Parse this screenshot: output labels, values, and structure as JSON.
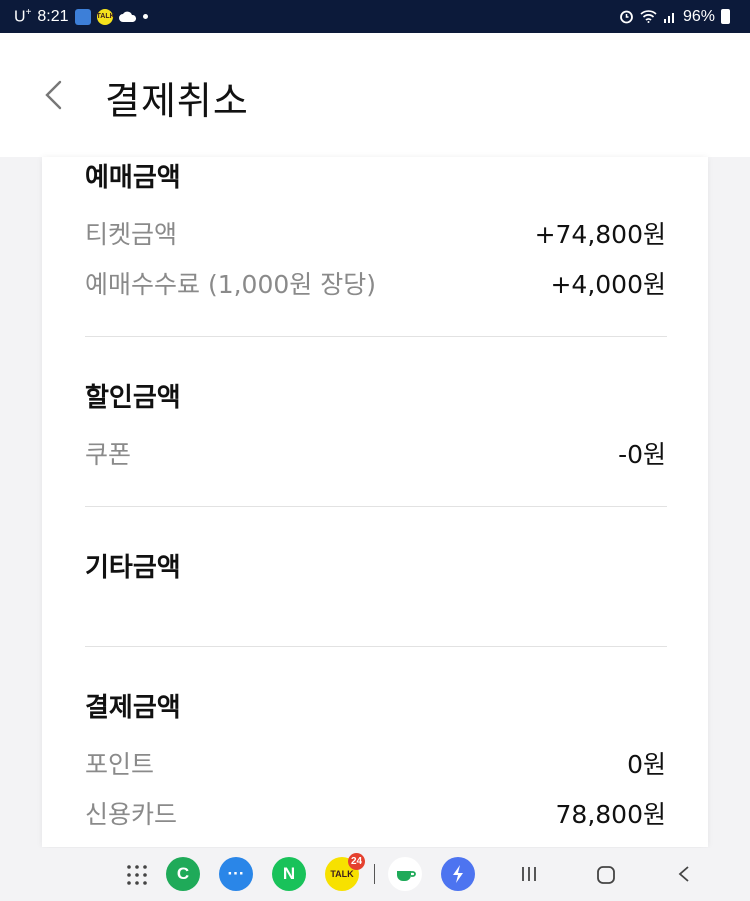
{
  "status_bar": {
    "carrier": "U",
    "carrier_sup": "+",
    "time": "8:21",
    "talk_label": "TALK",
    "battery": "96%"
  },
  "header": {
    "title": "결제취소"
  },
  "sections": [
    {
      "title": "예매금액",
      "rows": [
        {
          "label": "티켓금액",
          "value": "+74,800원"
        },
        {
          "label": "예매수수료 (1,000원 장당)",
          "value": "+4,000원"
        }
      ]
    },
    {
      "title": "할인금액",
      "rows": [
        {
          "label": "쿠폰",
          "value": "-0원"
        }
      ]
    },
    {
      "title": "기타금액",
      "rows": []
    },
    {
      "title": "결제금액",
      "rows": [
        {
          "label": "포인트",
          "value": "0원"
        },
        {
          "label": "신용카드",
          "value": "78,800원"
        }
      ]
    }
  ],
  "navbar": {
    "apps": [
      {
        "icon": "apps-grid-icon"
      },
      {
        "icon": "phone-app-icon",
        "glyph": "C",
        "color": "#1faa59"
      },
      {
        "icon": "messages-app-icon",
        "glyph": "···",
        "color": "#2a86e8"
      },
      {
        "icon": "naver-app-icon",
        "glyph": "N",
        "color": "#19c25a"
      },
      {
        "icon": "kakaotalk-app-icon",
        "glyph": "TALK",
        "color": "#f7e100",
        "badge": "24"
      },
      {
        "icon": "cup-app-icon",
        "color": "#ffffff"
      },
      {
        "icon": "bolt-app-icon",
        "color": "#4d74f0"
      }
    ]
  }
}
